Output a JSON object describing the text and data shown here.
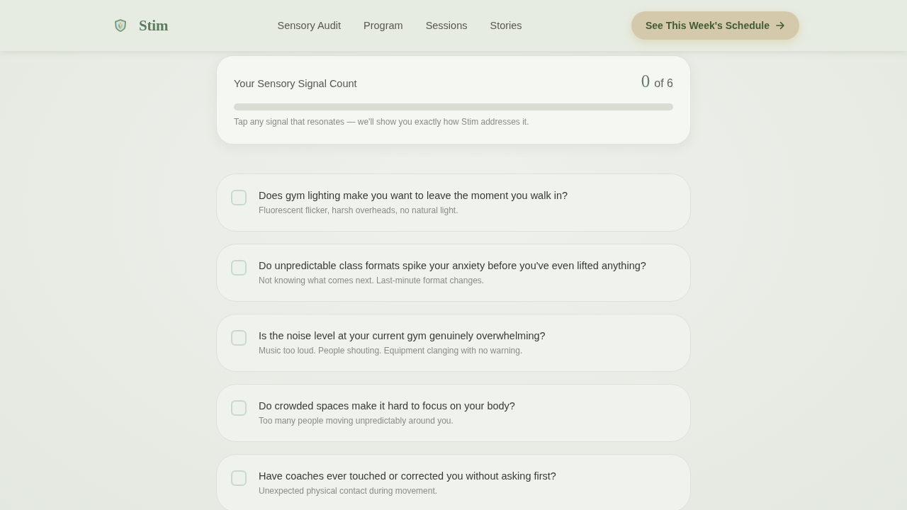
{
  "header": {
    "brand": "Stim",
    "nav": [
      "Sensory Audit",
      "Program",
      "Sessions",
      "Stories"
    ],
    "cta": "See This Week's Schedule"
  },
  "signal_count": {
    "title": "Your Sensory Signal Count",
    "count": "0",
    "total": "of 6",
    "level": 0,
    "hint": "Tap any signal that resonates — we'll show you exactly how Stim addresses it."
  },
  "signals": [
    {
      "question": "Does gym lighting make you want to leave the moment you walk in?",
      "detail": "Fluorescent flicker, harsh overheads, no natural light.",
      "checked": false
    },
    {
      "question": "Do unpredictable class formats spike your anxiety before you've even lifted anything?",
      "detail": "Not knowing what comes next. Last-minute format changes.",
      "checked": false
    },
    {
      "question": "Is the noise level at your current gym genuinely overwhelming?",
      "detail": "Music too loud. People shouting. Equipment clanging with no warning.",
      "checked": false
    },
    {
      "question": "Do crowded spaces make it hard to focus on your body?",
      "detail": "Too many people moving unpredictably around you.",
      "checked": false
    },
    {
      "question": "Have coaches ever touched or corrected you without asking first?",
      "detail": "Unexpected physical contact during movement.",
      "checked": false
    }
  ]
}
